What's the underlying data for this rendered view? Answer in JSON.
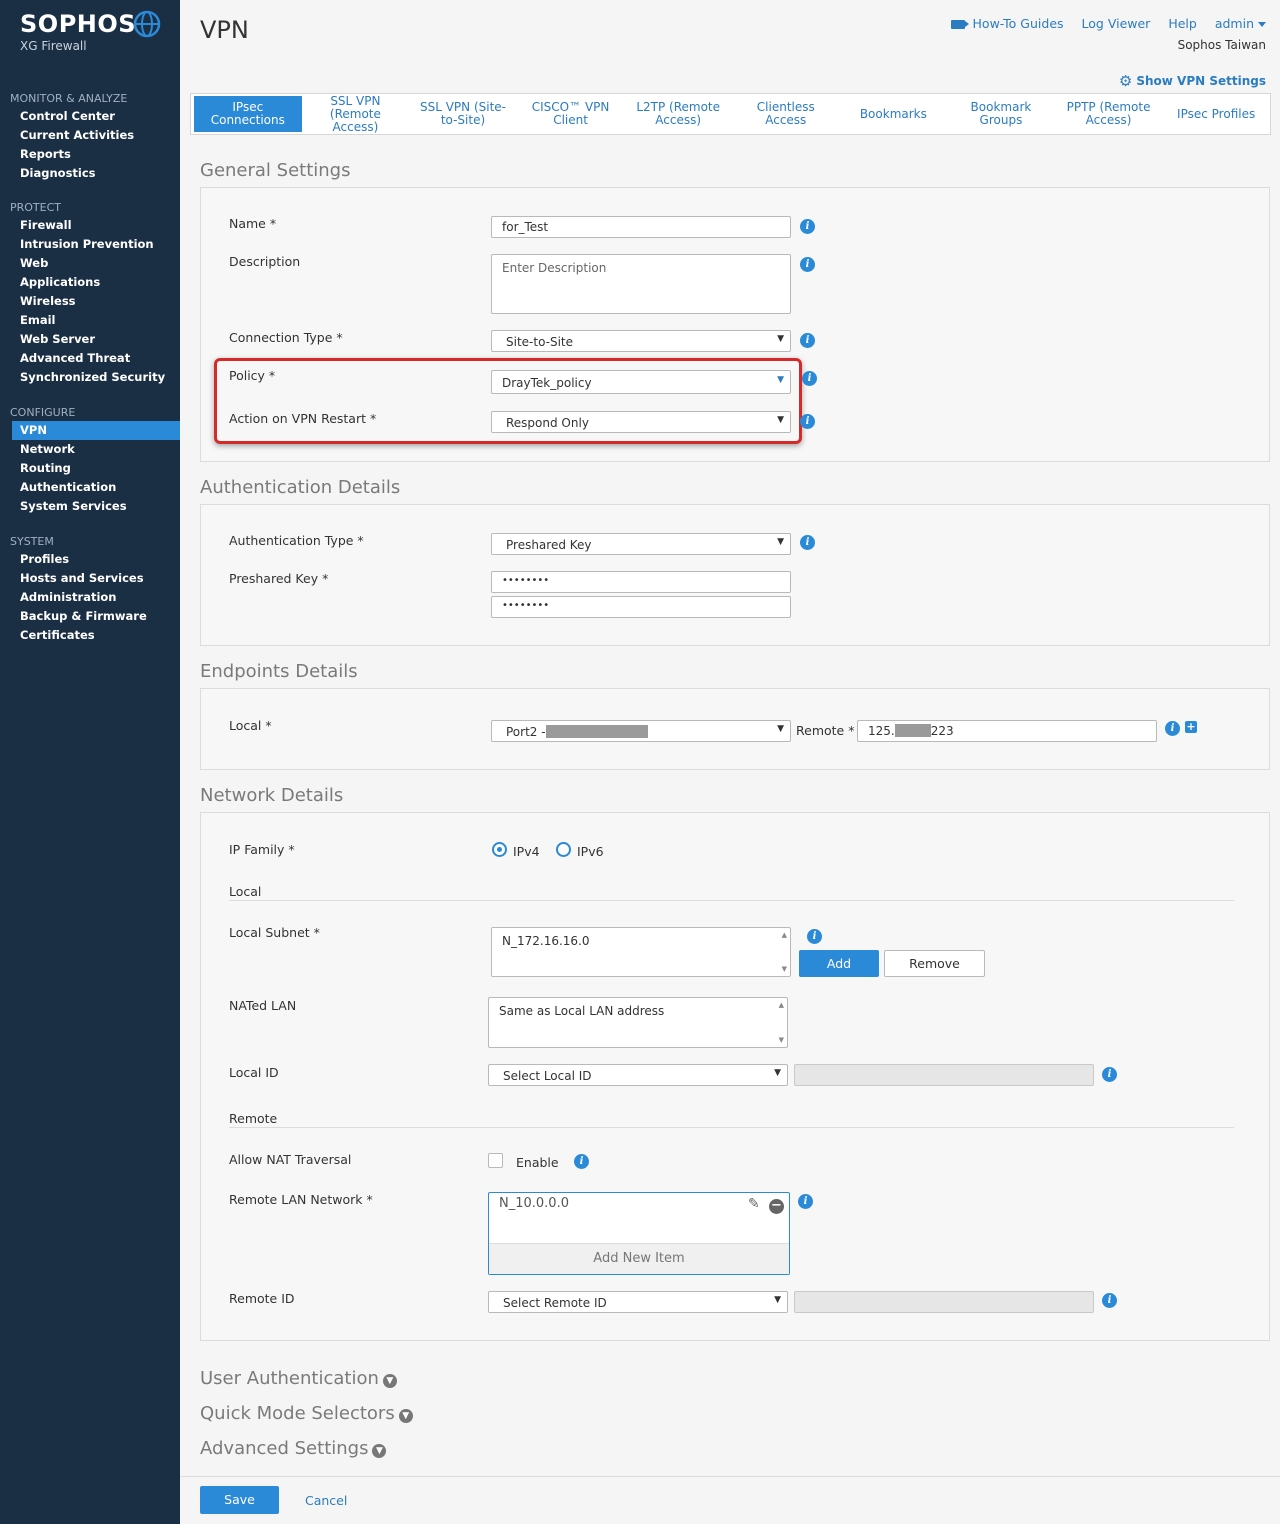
{
  "brand": {
    "name": "SOPHOS",
    "product": "XG Firewall"
  },
  "sidebar": {
    "sections": [
      {
        "title": "MONITOR & ANALYZE",
        "items": [
          "Control Center",
          "Current Activities",
          "Reports",
          "Diagnostics"
        ]
      },
      {
        "title": "PROTECT",
        "items": [
          "Firewall",
          "Intrusion Prevention",
          "Web",
          "Applications",
          "Wireless",
          "Email",
          "Web Server",
          "Advanced Threat",
          "Synchronized Security"
        ]
      },
      {
        "title": "CONFIGURE",
        "items": [
          "VPN",
          "Network",
          "Routing",
          "Authentication",
          "System Services"
        ]
      },
      {
        "title": "SYSTEM",
        "items": [
          "Profiles",
          "Hosts and Services",
          "Administration",
          "Backup & Firmware",
          "Certificates"
        ]
      }
    ],
    "active": "VPN"
  },
  "header": {
    "title": "VPN",
    "links": {
      "howto": "How-To Guides",
      "logviewer": "Log Viewer",
      "help": "Help",
      "admin": "admin"
    },
    "org": "Sophos Taiwan",
    "show_vpn_settings": "Show VPN Settings"
  },
  "tabs": [
    "IPsec Connections",
    "SSL VPN (Remote Access)",
    "SSL VPN (Site-to-Site)",
    "CISCO™ VPN Client",
    "L2TP (Remote Access)",
    "Clientless Access",
    "Bookmarks",
    "Bookmark Groups",
    "PPTP (Remote Access)",
    "IPsec Profiles"
  ],
  "general": {
    "title": "General Settings",
    "name_label": "Name *",
    "name_value": "for_Test",
    "description_label": "Description",
    "description_placeholder": "Enter Description",
    "connection_type_label": "Connection Type *",
    "connection_type_value": "Site-to-Site",
    "policy_label": "Policy *",
    "policy_value": "DrayTek_policy",
    "restart_label": "Action on VPN Restart *",
    "restart_value": "Respond Only"
  },
  "auth": {
    "title": "Authentication Details",
    "type_label": "Authentication Type *",
    "type_value": "Preshared Key",
    "key_label": "Preshared Key *",
    "key_value": "••••••••",
    "key_confirm": "••••••••"
  },
  "endpoints": {
    "title": "Endpoints Details",
    "local_label": "Local *",
    "local_value": "Port2 -",
    "remote_label": "Remote *",
    "remote_prefix": "125.",
    "remote_suffix": "223"
  },
  "network": {
    "title": "Network Details",
    "ip_family_label": "IP Family *",
    "ipv4": "IPv4",
    "ipv6": "IPv6",
    "local_heading": "Local",
    "local_subnet_label": "Local Subnet *",
    "local_subnet_value": "N_172.16.16.0",
    "add": "Add",
    "remove": "Remove",
    "nated_label": "NATed LAN",
    "nated_value": "Same as Local LAN address",
    "local_id_label": "Local ID",
    "local_id_value": "Select Local ID",
    "remote_heading": "Remote",
    "nat_traversal_label": "Allow NAT Traversal",
    "enable": "Enable",
    "remote_lan_label": "Remote LAN Network *",
    "remote_lan_value": "N_10.0.0.0",
    "add_new_item": "Add New Item",
    "remote_id_label": "Remote ID",
    "remote_id_value": "Select Remote ID"
  },
  "collapsed": {
    "user_auth": "User Authentication",
    "quick_mode": "Quick Mode Selectors",
    "advanced": "Advanced Settings"
  },
  "footer": {
    "save": "Save",
    "cancel": "Cancel"
  },
  "colors": {
    "sidebar": "#1b2f44",
    "accent": "#2b8ad8",
    "highlight": "#d42a2a"
  }
}
